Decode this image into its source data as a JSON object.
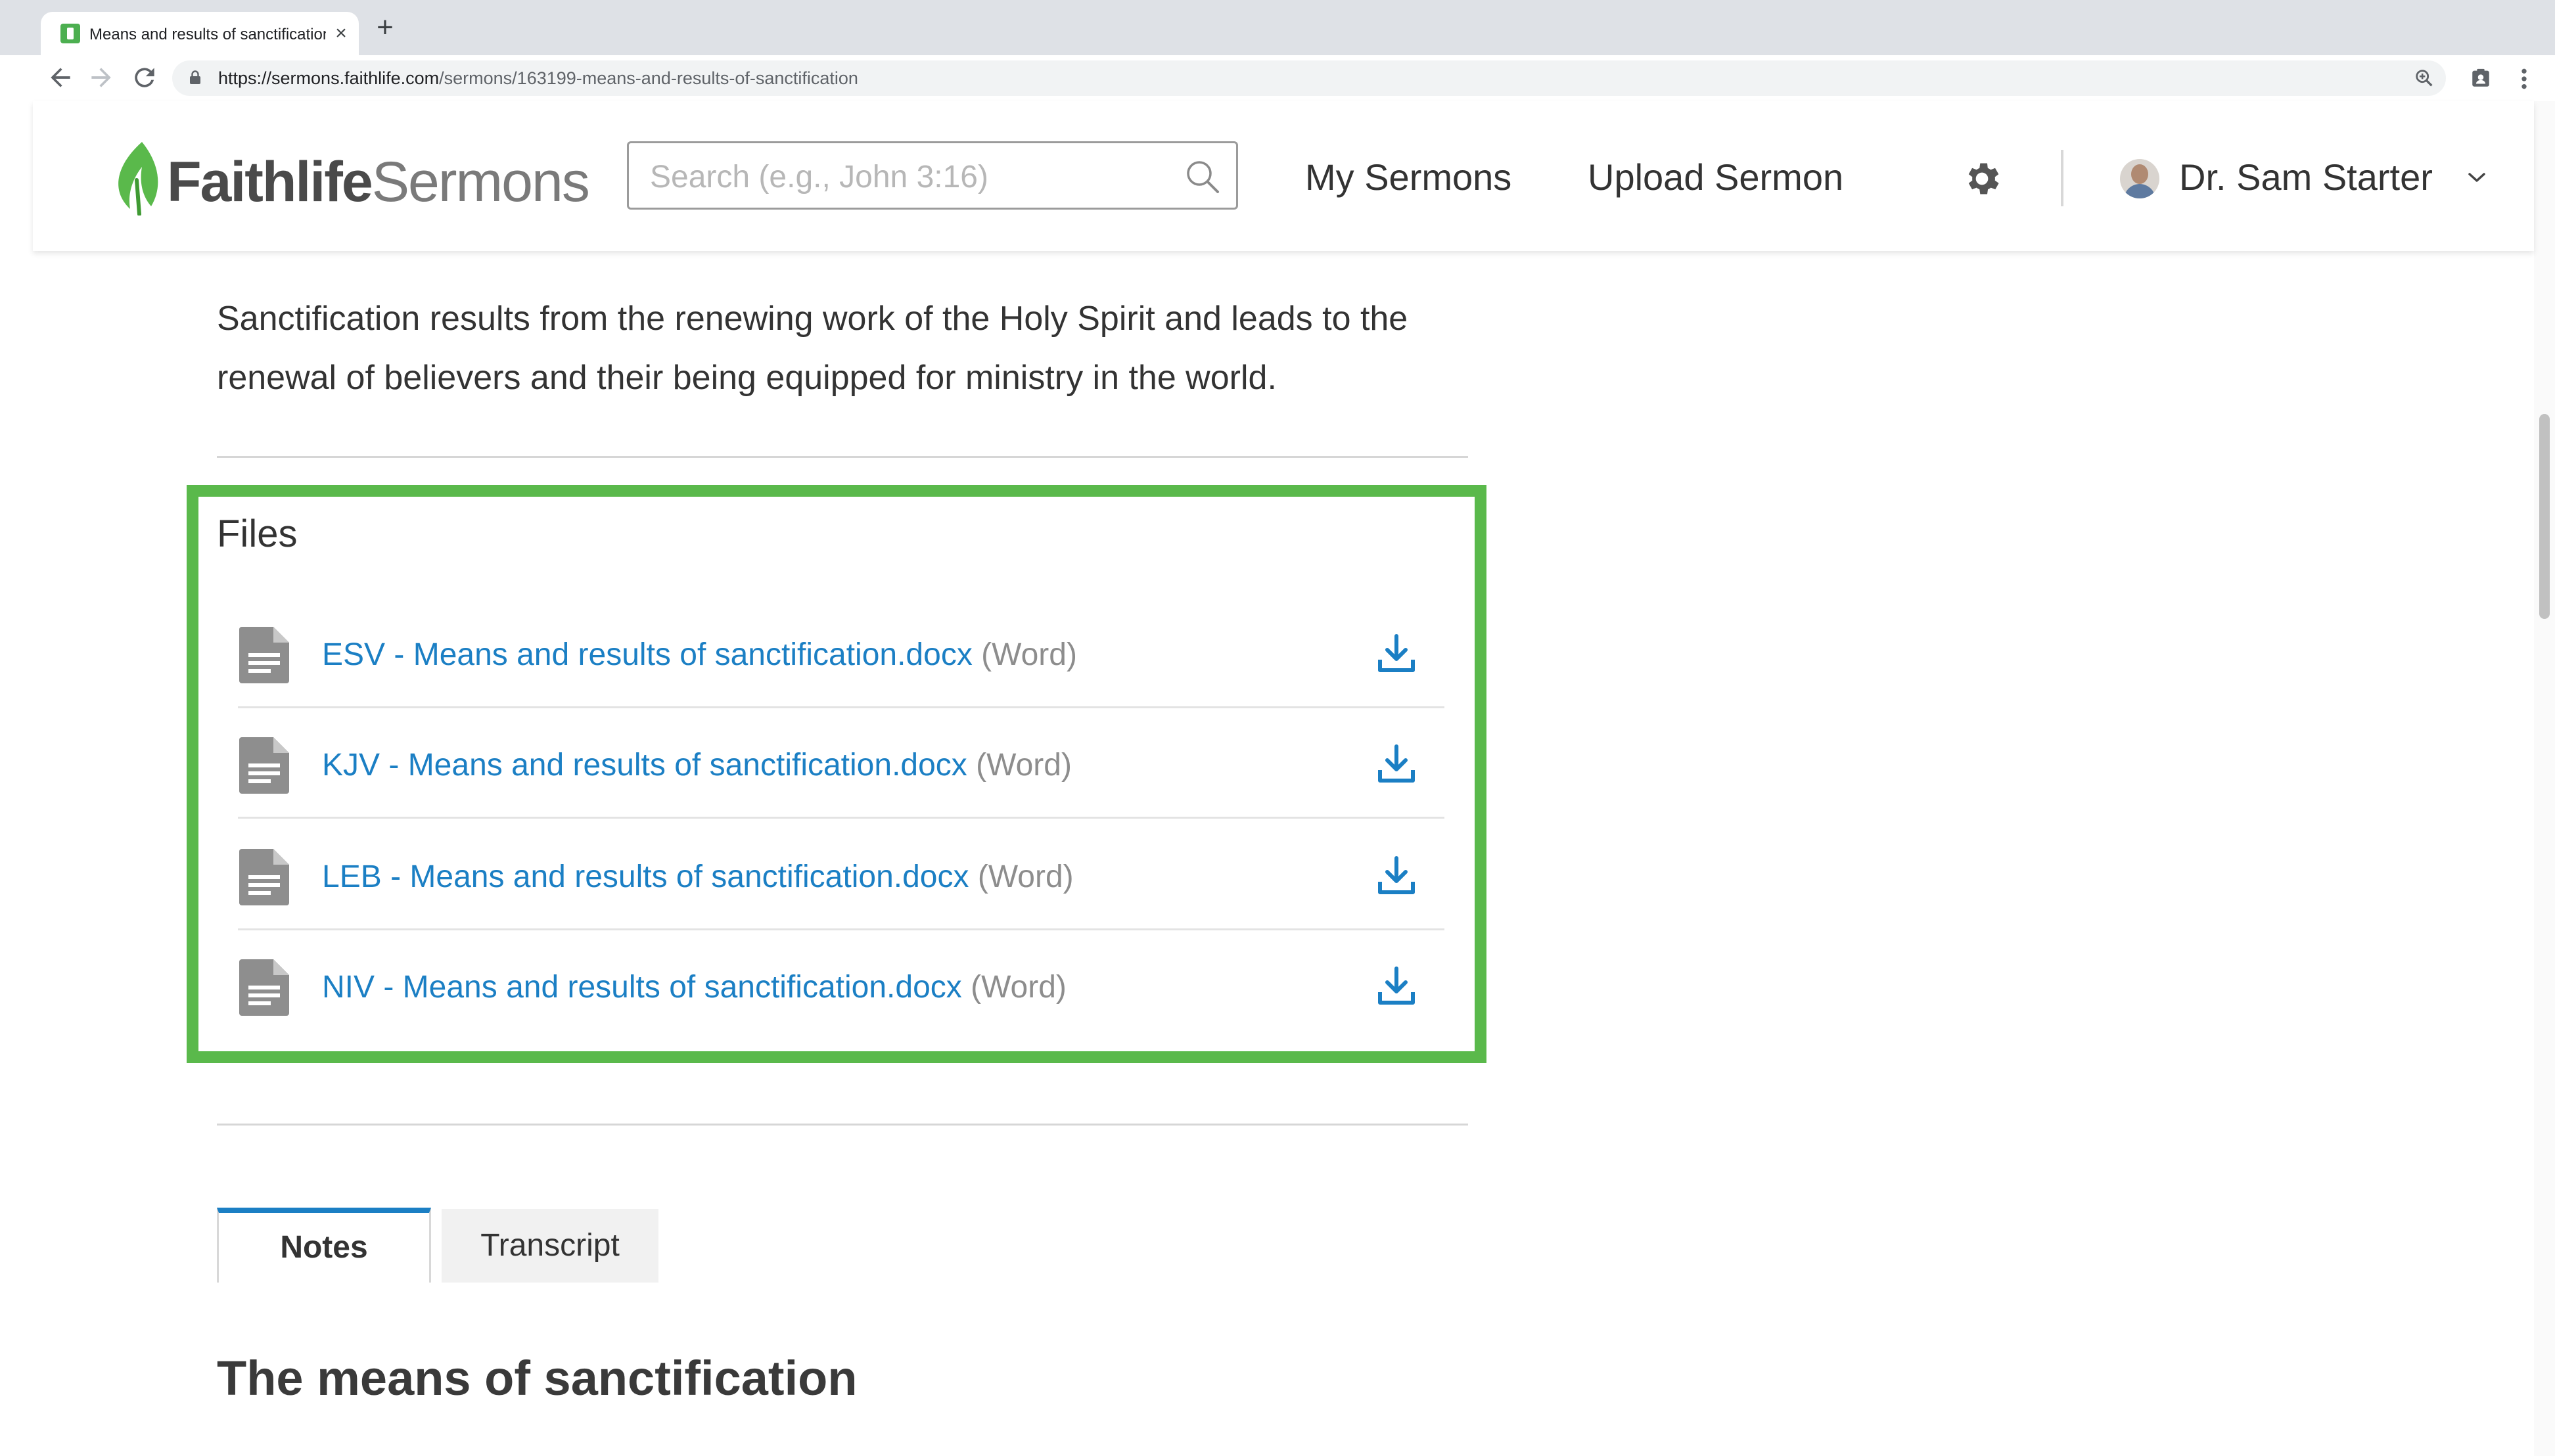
{
  "browser": {
    "tab_title": "Means and results of sanctification",
    "tab_close": "×",
    "new_tab": "+",
    "url_host": "https://sermons.faithlife.com",
    "url_path": "/sermons/163199-means-and-results-of-sanctification"
  },
  "header": {
    "logo_bold": "Faithlife",
    "logo_light": "Sermons",
    "search_placeholder": "Search (e.g., John 3:16)",
    "nav_my_sermons": "My Sermons",
    "nav_upload": "Upload Sermon",
    "user_name": "Dr. Sam Starter",
    "brand_green": "#5ab94b",
    "link_blue": "#1b7fc4"
  },
  "main": {
    "summary": "Sanctification results from the renewing work of the Holy Spirit and leads to the renewal of believers and their being equipped for ministry in the world.",
    "files_title": "Files",
    "files": [
      {
        "name": "ESV - Means and results of sanctification.docx",
        "type": "(Word)"
      },
      {
        "name": "KJV - Means and results of sanctification.docx",
        "type": "(Word)"
      },
      {
        "name": "LEB - Means and results of sanctification.docx",
        "type": "(Word)"
      },
      {
        "name": "NIV - Means and results of sanctification.docx",
        "type": "(Word)"
      }
    ],
    "tabs": [
      {
        "label": "Notes",
        "active": true
      },
      {
        "label": "Transcript",
        "active": false
      }
    ],
    "section_heading": "The means of sanctification"
  }
}
